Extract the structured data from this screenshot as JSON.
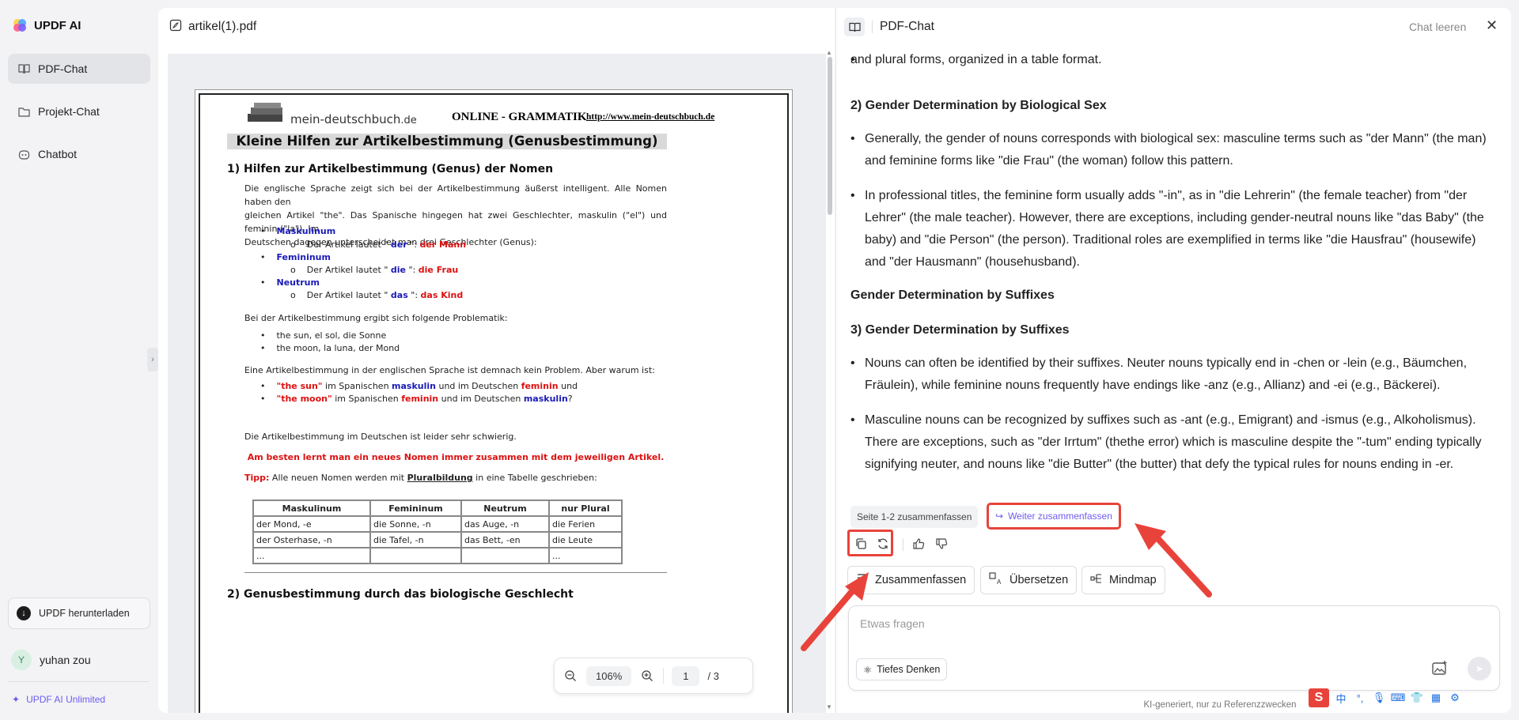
{
  "app": {
    "name": "UPDF AI"
  },
  "sidebar": {
    "items": [
      {
        "label": "PDF-Chat",
        "icon": "book-icon"
      },
      {
        "label": "Projekt-Chat",
        "icon": "folder-icon"
      },
      {
        "label": "Chatbot",
        "icon": "bot-icon"
      }
    ],
    "download_label": "UPDF herunterladen",
    "user_initial": "Y",
    "user_name": "yuhan zou",
    "unlimited_label": "UPDF AI Unlimited"
  },
  "pdf": {
    "filename": "artikel(1).pdf",
    "zoom": "106%",
    "page_current": "1",
    "page_total": "/ 3",
    "doc": {
      "brand": "mein-deutschbuch",
      "brand_tld": ".de",
      "header_title": "ONLINE - GRAMMATIK",
      "header_url": "http://www.mein-deutschbuch.de",
      "banner": "Kleine Hilfen zur Artikelbestimmung   (Genusbestimmung)",
      "section1": "1) Hilfen zur Artikelbestimmung (Genus) der Nomen",
      "intro_1": "Die englische Sprache zeigt sich bei der Artikelbestimmung äußerst intelligent. Alle Nomen haben den",
      "intro_2": "gleichen Artikel \"the\". Das Spanische hingegen hat zwei Geschlechter, maskulin (\"el\") und feminin (\"la\"). Im",
      "intro_3": "Deutschen dagegen unterscheidet man drei Geschlechter (Genus):",
      "genders": [
        {
          "name": "Maskulinum",
          "pre": "Der Artikel lautet \" ",
          "art": "der",
          "mid": " \": ",
          "ex": "der Mann"
        },
        {
          "name": "Femininum",
          "pre": "Der Artikel lautet \" ",
          "art": "die",
          "mid": " \": ",
          "ex": "die Frau"
        },
        {
          "name": "Neutrum",
          "pre": "Der Artikel lautet \" ",
          "art": "das",
          "mid": " \": ",
          "ex": "das Kind"
        }
      ],
      "problem_intro": "Bei der Artikelbestimmung ergibt sich folgende Problematik:",
      "examples": [
        "the sun, el sol, die Sonne",
        "the moon, la luna, der Mond"
      ],
      "question": "Eine Artikelbestimmung in der englischen Sprache ist demnach kein Problem. Aber warum ist:",
      "q1": {
        "a": "\"the sun\"",
        "b": " im Spanischen ",
        "c": "maskulin",
        "d": " und im Deutschen ",
        "e": "feminin",
        "f": " und"
      },
      "q2": {
        "a": "\"the moon\"",
        "b": " im Spanischen ",
        "c": "feminin",
        "d": " und im Deutschen ",
        "e": "maskulin",
        "f": "?"
      },
      "difficult": "Die Artikelbestimmung im Deutschen ist leider sehr schwierig.",
      "advice": "Am besten lernt man ein neues Nomen immer zusammen mit dem jeweiligen Artikel.",
      "tipp_label": "Tipp:",
      "tipp_a": " Alle neuen Nomen werden mit ",
      "tipp_b": "Pluralbildung",
      "tipp_c": " in eine Tabelle geschrieben:",
      "table_headers": [
        "Maskulinum",
        "Femininum",
        "Neutrum",
        "nur Plural"
      ],
      "table_rows": [
        [
          "der Mond, -e",
          "die Sonne, -n",
          "das Auge, -n",
          "die Ferien"
        ],
        [
          "der Osterhase, -n",
          "die Tafel, -n",
          "das Bett, -en",
          "die Leute"
        ],
        [
          "...",
          "",
          "",
          "..."
        ]
      ],
      "section2": "2) Genusbestimmung durch das biologische Geschlecht"
    }
  },
  "chat": {
    "title": "PDF-Chat",
    "clear_label": "Chat leeren",
    "top_line": "and plural forms, organized in a table format.",
    "h2": "2) Gender Determination by Biological Sex",
    "b1": "Generally, the gender of nouns corresponds with biological sex: masculine terms such as \"der Mann\" (the man) and feminine forms like \"die Frau\" (the woman) follow this pattern.",
    "b2": "In professional titles, the feminine form usually adds \"-in\", as in \"die Lehrerin\" (the female teacher) from \"der Lehrer\" (the male teacher). However, there are exceptions, including gender-neutral nouns like \"das Baby\" (the baby) and \"die Person\" (the person). Traditional roles are exemplified in terms like \"die Hausfrau\" (housewife) and \"der Hausmann\" (househusband).",
    "h_suffix_plain": "Gender Determination by Suffixes",
    "h3": "3) Gender Determination by Suffixes",
    "b3": "Nouns can often be identified by their suffixes. Neuter nouns typically end in -chen or -lein (e.g., Bäumchen, Fräulein), while feminine nouns frequently have endings like -anz (e.g., Allianz) and -ei (e.g., Bäckerei).",
    "b4": "Masculine nouns can be recognized by suffixes such as -ant (e.g., Emigrant) and -ismus (e.g., Alkoholismus). There are exceptions, such as \"der Irrtum\" (thethe error) which is masculine despite the \"-tum\" ending typically signifying neuter, and nouns like \"die Butter\" (the butter) that defy the typical rules for nouns ending in -er.",
    "chip_summary_pages": "Seite 1-2 zusammenfassen",
    "chip_continue": "Weiter zusammenfassen",
    "quick_actions": [
      "Zusammenfassen",
      "Übersetzen",
      "Mindmap"
    ],
    "input_placeholder": "Etwas fragen",
    "deep_label": "Tiefes Denken",
    "footnote": "KI-generiert, nur zu Referenzzwecken"
  },
  "tray": {
    "ime": "中"
  },
  "colors": {
    "accent": "#6b5cf0",
    "highlight": "#e8433b"
  }
}
